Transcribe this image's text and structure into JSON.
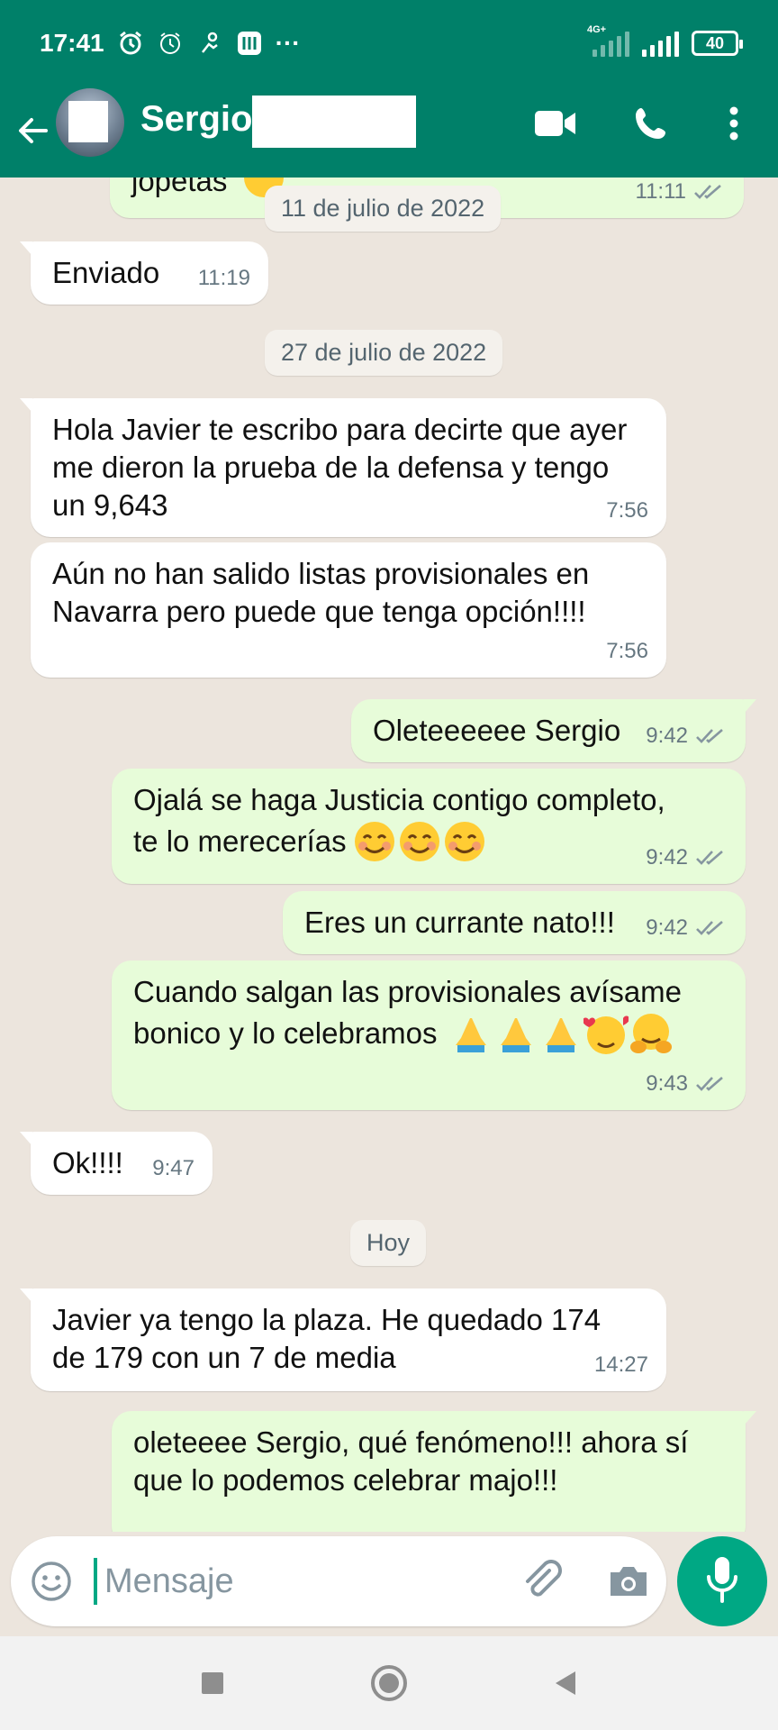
{
  "status_bar": {
    "time": "17:41",
    "network_label": "4G+",
    "more": "···",
    "battery": "40"
  },
  "header": {
    "contact_name": "Sergio",
    "icons": [
      "back-arrow-icon",
      "video-call-icon",
      "phone-icon",
      "more-vertical-icon"
    ],
    "color": "#008069"
  },
  "chat": {
    "partial_top": {
      "text": "jopetas",
      "time": "11:11"
    },
    "date_1": "11 de julio de 2022",
    "msg_enviado": {
      "text": "Enviado",
      "time": "11:19"
    },
    "date_2": "27 de julio de 2022",
    "msg_hola": {
      "text": "Hola Javier te escribo para decirte que ayer me dieron la prueba de la defensa y tengo un 9,643",
      "time": "7:56"
    },
    "msg_aun": {
      "text": "Aún no han salido listas provisionales en Navarra pero puede que tenga opción!!!!",
      "time": "7:56"
    },
    "msg_olete": {
      "text": "Oleteeeeee Sergio",
      "time": "9:42"
    },
    "msg_ojala": {
      "line1": "Ojalá se haga Justicia contigo completo,",
      "line2": "te lo merecerías",
      "time": "9:42"
    },
    "msg_currante": {
      "text": "Eres un currante nato!!!",
      "time": "9:42"
    },
    "msg_cuando": {
      "line1": "Cuando salgan las provisionales avísame",
      "line2": "bonico y lo celebramos",
      "time": "9:43"
    },
    "msg_ok": {
      "text": "Ok!!!!",
      "time": "9:47"
    },
    "date_3": "Hoy",
    "msg_plaza": {
      "text": "Javier ya tengo la plaza. He quedado 174 de 179 con un 7 de media",
      "time": "14:27"
    },
    "msg_fenomeno": {
      "text": "oleteeee Sergio, qué fenómeno!!! ahora sí que lo podemos celebrar majo!!!"
    }
  },
  "composer": {
    "placeholder": "Mensaje",
    "icons": [
      "emoji-icon",
      "attach-clip-icon",
      "camera-icon",
      "mic-icon"
    ]
  },
  "colors": {
    "incoming": "#ffffff",
    "outgoing": "#e7fcd9",
    "chat_bg": "#ece5dd",
    "accent": "#00a884",
    "read_ticks": "#8696a0"
  }
}
